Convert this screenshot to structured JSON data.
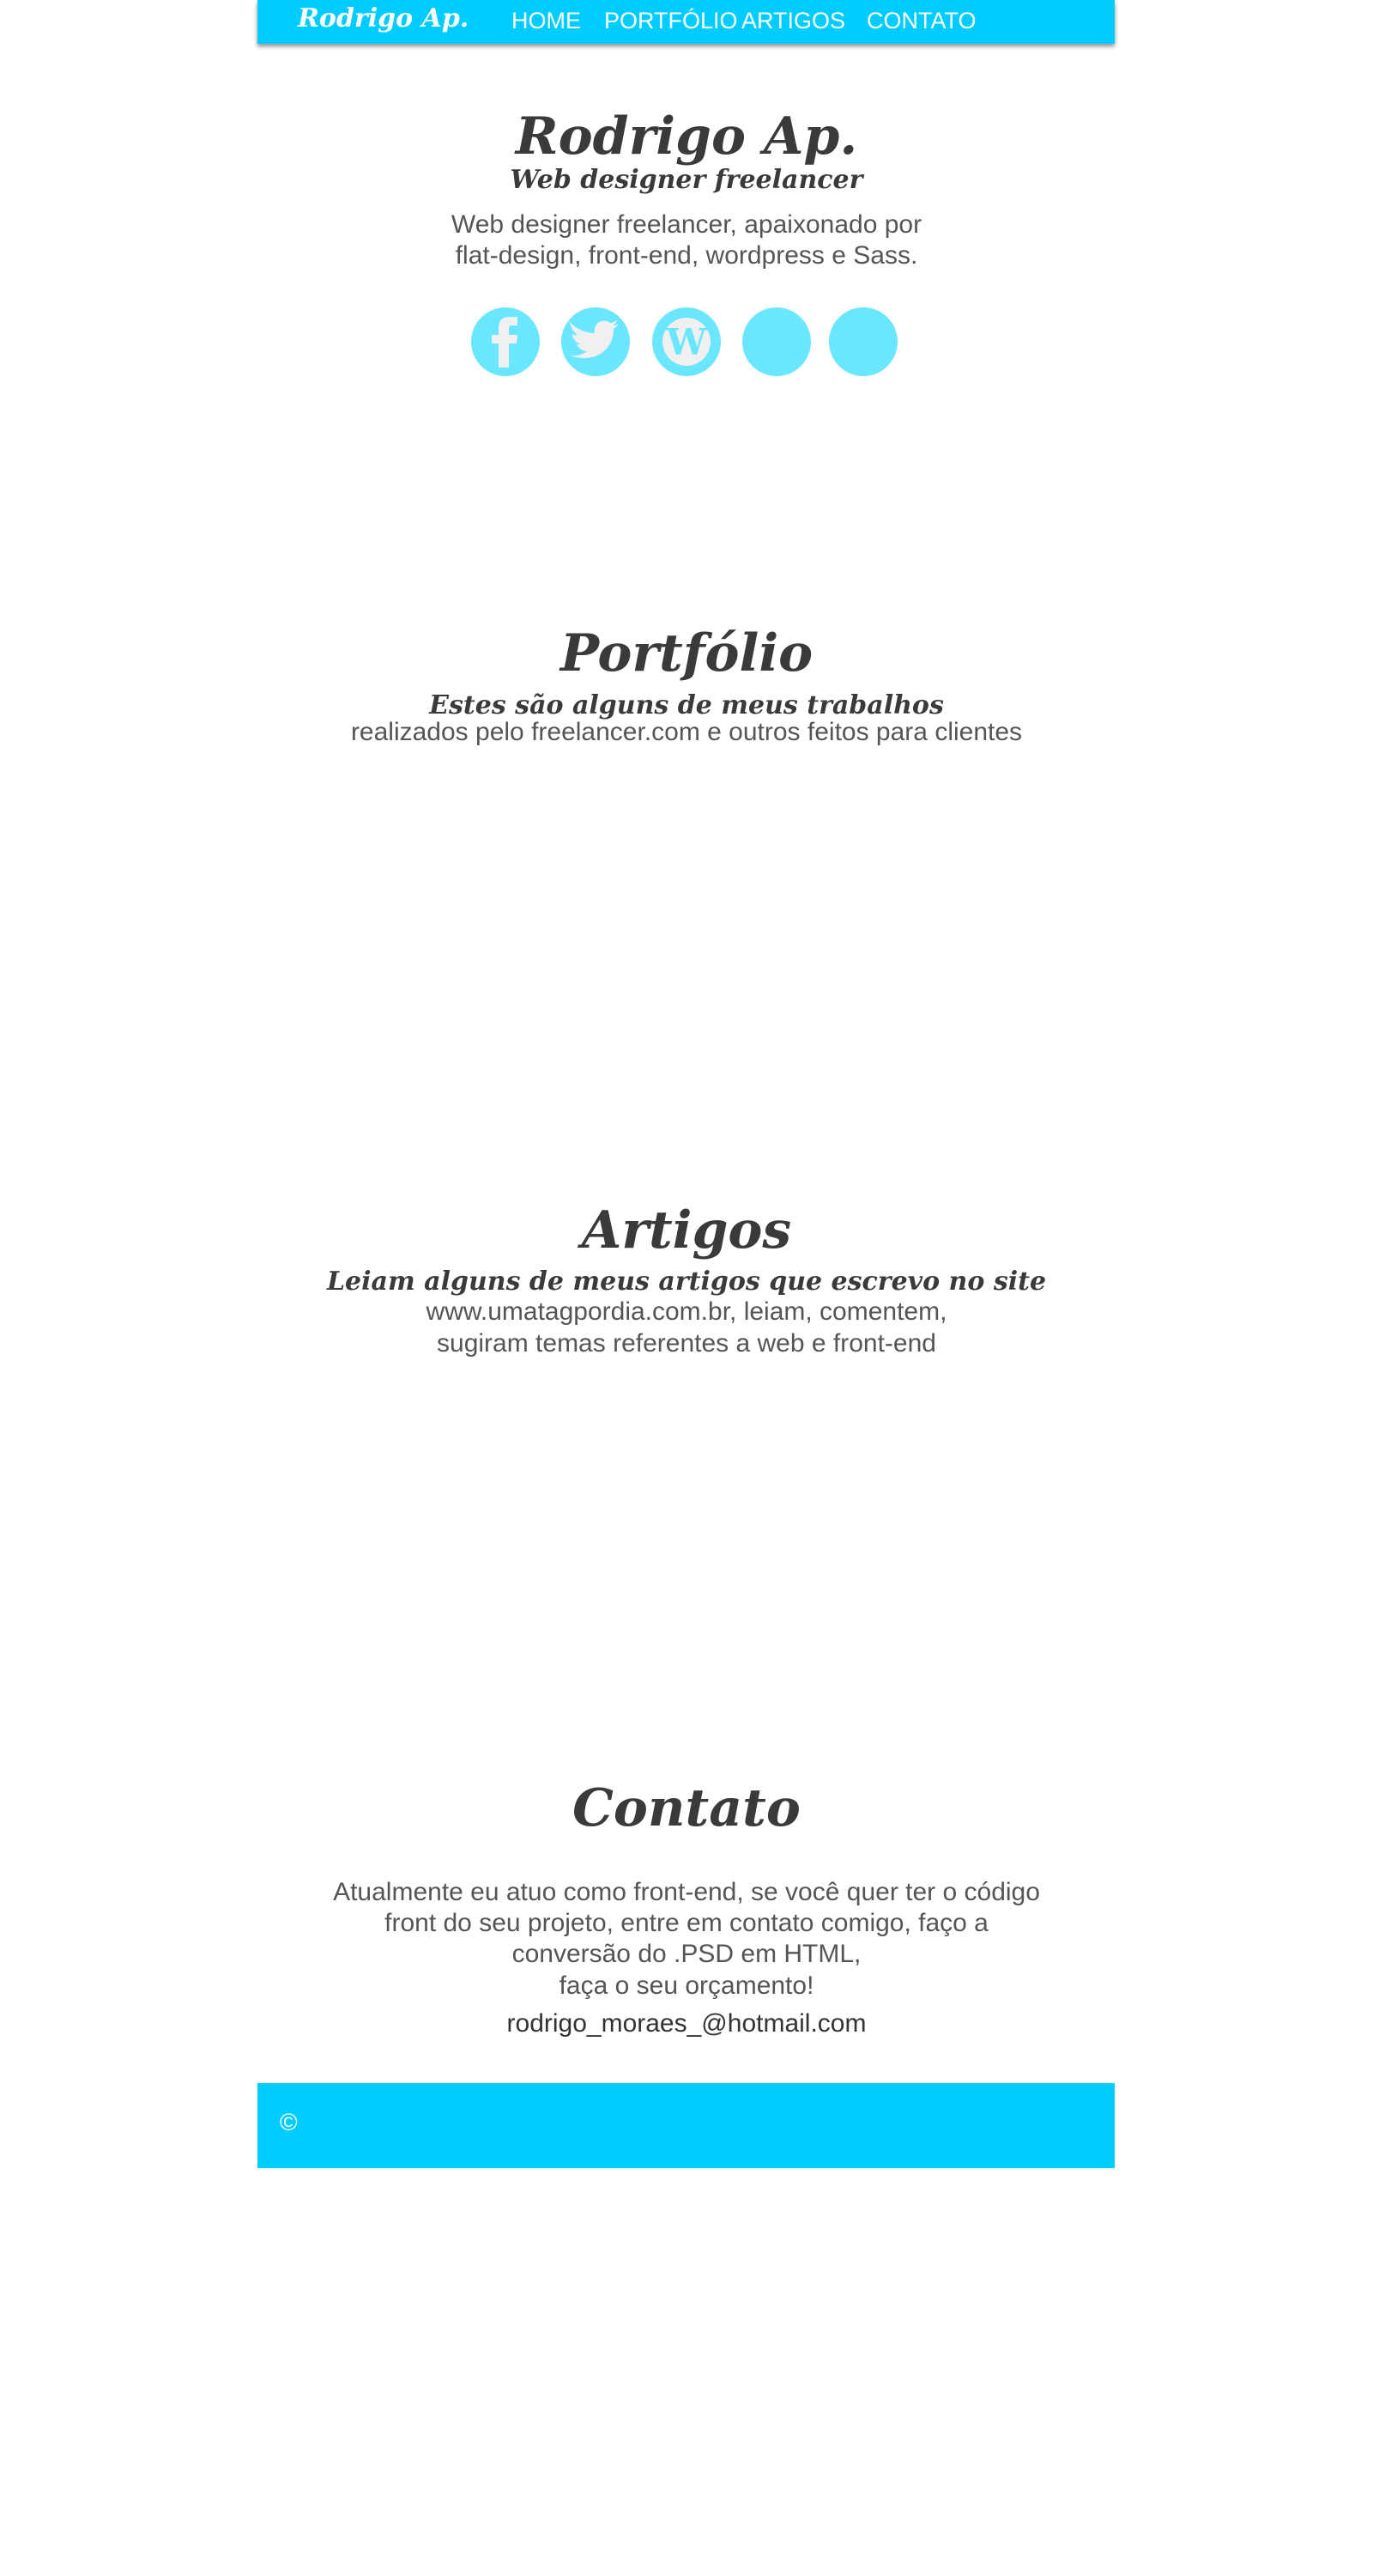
{
  "nav": {
    "brand": "Rodrigo Ap.",
    "items": [
      "HOME",
      "PORTFÓLIO",
      "ARTIGOS",
      "CONTATO"
    ]
  },
  "hero": {
    "title": "Rodrigo Ap.",
    "subtitle": "Web designer freelancer",
    "desc": [
      "Web designer freelancer, apaixonado por",
      "flat-design, front-end, wordpress e Sass."
    ],
    "social_icons": [
      "facebook-icon",
      "twitter-icon",
      "wordpress-icon",
      "social-icon-4",
      "social-icon-5"
    ]
  },
  "portfolio": {
    "title": "Portfólio",
    "subtitle": "Estes são alguns de meus trabalhos",
    "desc": "realizados pelo freelancer.com e outros feitos para clientes"
  },
  "artigos": {
    "title": "Artigos",
    "subtitle": "Leiam alguns de meus artigos que escrevo no site",
    "desc": [
      "www.umatagpordia.com.br, leiam, comentem,",
      "sugiram temas referentes a web e front-end"
    ]
  },
  "contato": {
    "title": "Contato",
    "desc": [
      "Atualmente eu atuo como front-end, se você quer ter o código",
      "front do seu projeto, entre em contato comigo, faço a",
      "conversão do .PSD em HTML,",
      "faça o seu orçamento!"
    ],
    "email": "rodrigo_moraes_@hotmail.com"
  },
  "footer": {
    "copyright": "©"
  },
  "colors": {
    "accent": "#00ccff",
    "icon_bg": "#6ae6ff",
    "text": "#3a3a3a"
  }
}
